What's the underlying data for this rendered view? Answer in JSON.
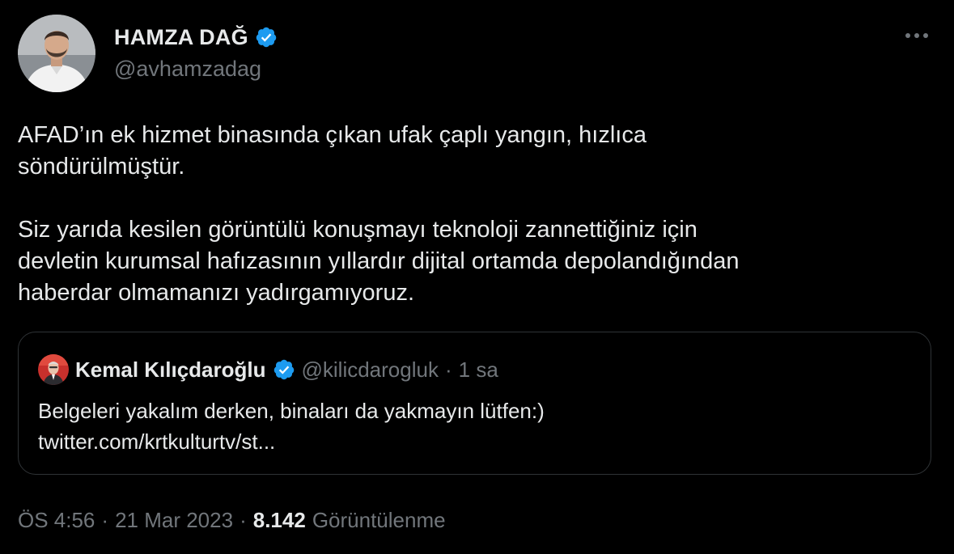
{
  "author": {
    "display_name": "HAMZA DAĞ",
    "handle": "@avhamzadag",
    "verified_icon": "verified-badge-icon",
    "avatar_icon": "profile-photo",
    "more_icon": "more-options-icon"
  },
  "tweet": {
    "paragraphs": [
      "AFAD’ın ek hizmet binasında çıkan ufak çaplı yangın, hızlıca\nsöndürülmüştür.",
      "Siz yarıda kesilen görüntülü konuşmayı teknoloji zannettiğiniz için\ndevletin kurumsal hafızasının yıllardır dijital ortamda depolandığından\nhaberdar olmamanızı yadırgamıyoruz."
    ]
  },
  "quote": {
    "display_name": "Kemal Kılıçdaroğlu",
    "handle": "@kilicdarogluk",
    "separator": "·",
    "time": "1 sa",
    "text": "Belgeleri yakalım derken, binaları da yakmayın lütfen:)",
    "link": "twitter.com/krtkulturtv/st..."
  },
  "meta": {
    "time": "ÖS 4:56",
    "separator1": "·",
    "date": "21 Mar 2023",
    "separator2": "·",
    "views_count": "8.142",
    "views_label": "Görüntülenme"
  },
  "colors": {
    "background": "#000000",
    "text_primary": "#e7e9ea",
    "text_secondary": "#71767b",
    "verified_blue": "#1d9bf0",
    "border": "#2f3336"
  }
}
